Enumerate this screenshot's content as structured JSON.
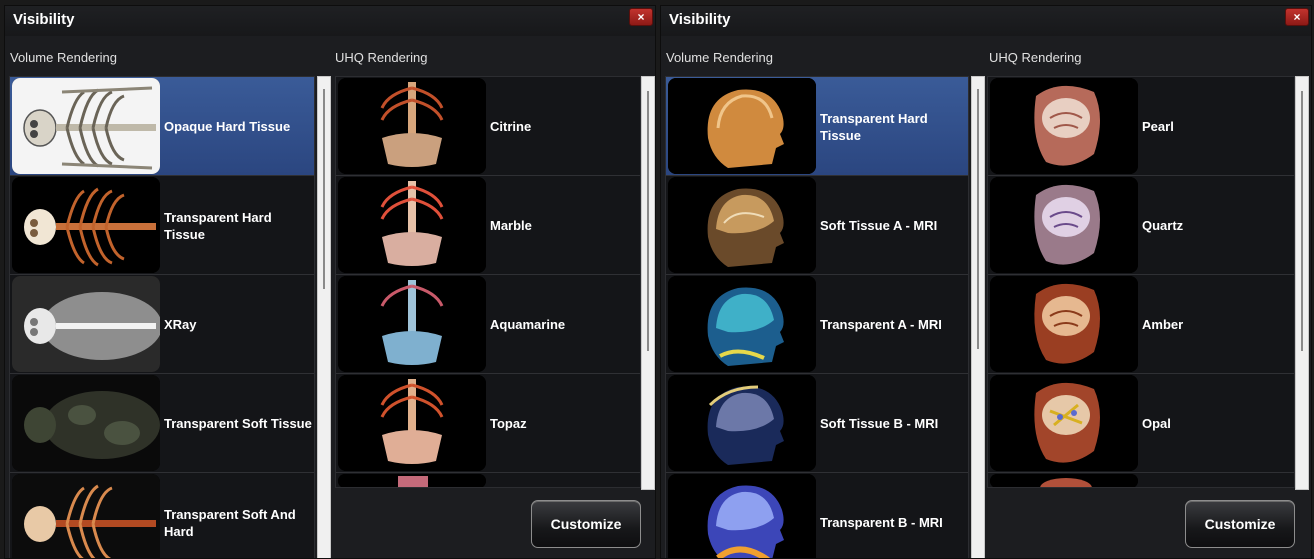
{
  "colors": {
    "selected": "#2f4c88",
    "close": "#b02a25",
    "panel": "#1c1d20"
  },
  "panels": [
    {
      "title": "Visibility",
      "close_glyph": "×",
      "volume_label": "Volume Rendering",
      "uhq_label": "UHQ Rendering",
      "customize_label": "Customize",
      "volume_items": [
        {
          "label": "Opaque Hard Tissue",
          "selected": true
        },
        {
          "label": "Transparent Hard Tissue",
          "selected": false
        },
        {
          "label": "XRay",
          "selected": false
        },
        {
          "label": "Transparent Soft Tissue",
          "selected": false
        },
        {
          "label": "Transparent Soft And Hard",
          "selected": false
        }
      ],
      "uhq_items": [
        {
          "label": "Citrine"
        },
        {
          "label": "Marble"
        },
        {
          "label": "Aquamarine"
        },
        {
          "label": "Topaz"
        }
      ]
    },
    {
      "title": "Visibility",
      "close_glyph": "×",
      "volume_label": "Volume Rendering",
      "uhq_label": "UHQ Rendering",
      "customize_label": "Customize",
      "volume_items": [
        {
          "label": "Transparent Hard Tissue",
          "selected": true
        },
        {
          "label": "Soft Tissue A - MRI",
          "selected": false
        },
        {
          "label": "Transparent A - MRI",
          "selected": false
        },
        {
          "label": "Soft Tissue B - MRI",
          "selected": false
        },
        {
          "label": "Transparent B - MRI",
          "selected": false
        }
      ],
      "uhq_items": [
        {
          "label": "Pearl"
        },
        {
          "label": "Quartz"
        },
        {
          "label": "Amber"
        },
        {
          "label": "Opal"
        }
      ]
    }
  ]
}
